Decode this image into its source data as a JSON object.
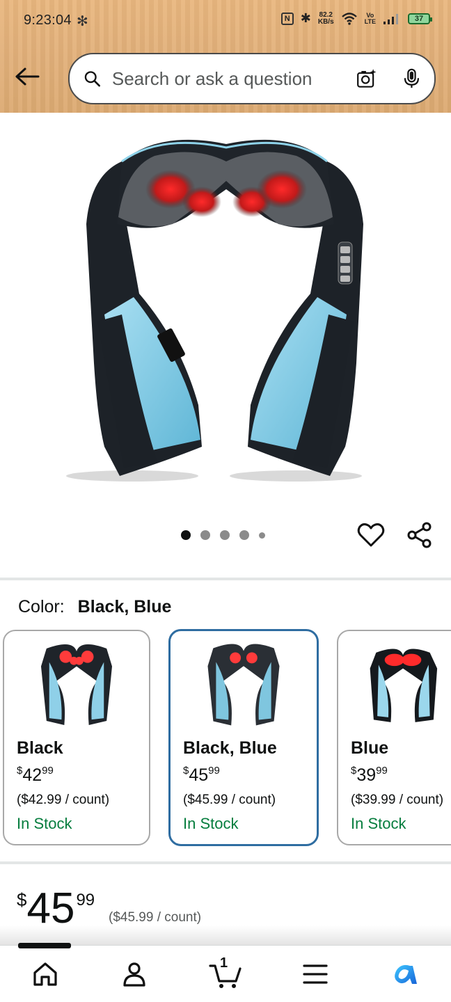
{
  "status_bar": {
    "time": "9:23:04",
    "network_speed_value": "82.2",
    "network_speed_unit": "KB/s",
    "lte_top": "Vo",
    "lte_bottom": "LTE",
    "battery": "37"
  },
  "header": {
    "search_placeholder": "Search or ask a question"
  },
  "gallery": {
    "dot_count": 5,
    "active_index": 0
  },
  "variations": {
    "label": "Color:",
    "selected": "Black, Blue",
    "options": [
      {
        "name": "Black",
        "price_whole": "42",
        "price_frac": "99",
        "per_count": "($42.99 / count)",
        "stock": "In Stock",
        "selected": false
      },
      {
        "name": "Black, Blue",
        "price_whole": "45",
        "price_frac": "99",
        "per_count": "($45.99 / count)",
        "stock": "In Stock",
        "selected": true
      },
      {
        "name": "Blue",
        "price_whole": "39",
        "price_frac": "99",
        "per_count": "($39.99 / count)",
        "stock": "In Stock",
        "selected": false
      }
    ]
  },
  "price": {
    "currency": "$",
    "whole": "45",
    "frac": "99",
    "per_count": "($45.99 / count)"
  },
  "bottom_nav": {
    "cart_count": "1",
    "items": [
      "home-icon",
      "account-icon",
      "cart-icon",
      "menu-icon",
      "rufus-icon"
    ]
  },
  "colors": {
    "header": "#e2b07a",
    "stock_green": "#067d3e",
    "selected_border": "#2f6da1",
    "rufus_blue": "#1f8fdc"
  }
}
